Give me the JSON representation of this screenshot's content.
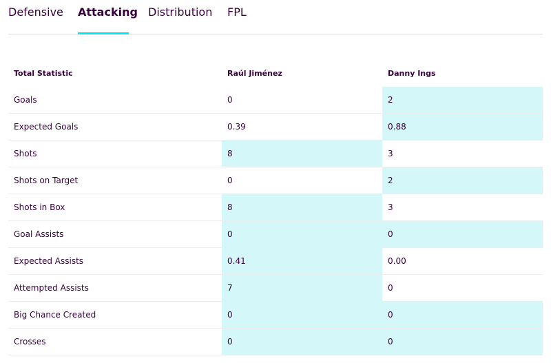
{
  "tabs": [
    {
      "label": "Defensive",
      "active": false
    },
    {
      "label": "Attacking",
      "active": true
    },
    {
      "label": "Distribution",
      "active": false
    },
    {
      "label": "FPL",
      "active": false
    }
  ],
  "table": {
    "headers": [
      "Total Statistic",
      "Raúl Jiménez",
      "Danny Ings"
    ],
    "highlight_color": "#d4f7f9",
    "accent_color": "#05e5ee",
    "rows": [
      {
        "stat": "Goals",
        "player1": "0",
        "player2": "2",
        "highlight": [
          false,
          true
        ]
      },
      {
        "stat": "Expected Goals",
        "player1": "0.39",
        "player2": "0.88",
        "highlight": [
          false,
          true
        ]
      },
      {
        "stat": "Shots",
        "player1": "8",
        "player2": "3",
        "highlight": [
          true,
          false
        ]
      },
      {
        "stat": "Shots on Target",
        "player1": "0",
        "player2": "2",
        "highlight": [
          false,
          true
        ]
      },
      {
        "stat": "Shots in Box",
        "player1": "8",
        "player2": "3",
        "highlight": [
          true,
          false
        ]
      },
      {
        "stat": "Goal Assists",
        "player1": "0",
        "player2": "0",
        "highlight": [
          true,
          true
        ]
      },
      {
        "stat": "Expected Assists",
        "player1": "0.41",
        "player2": "0.00",
        "highlight": [
          true,
          false
        ]
      },
      {
        "stat": "Attempted Assists",
        "player1": "7",
        "player2": "0",
        "highlight": [
          true,
          false
        ]
      },
      {
        "stat": "Big Chance Created",
        "player1": "0",
        "player2": "0",
        "highlight": [
          true,
          true
        ]
      },
      {
        "stat": "Crosses",
        "player1": "0",
        "player2": "0",
        "highlight": [
          true,
          true
        ]
      }
    ]
  }
}
